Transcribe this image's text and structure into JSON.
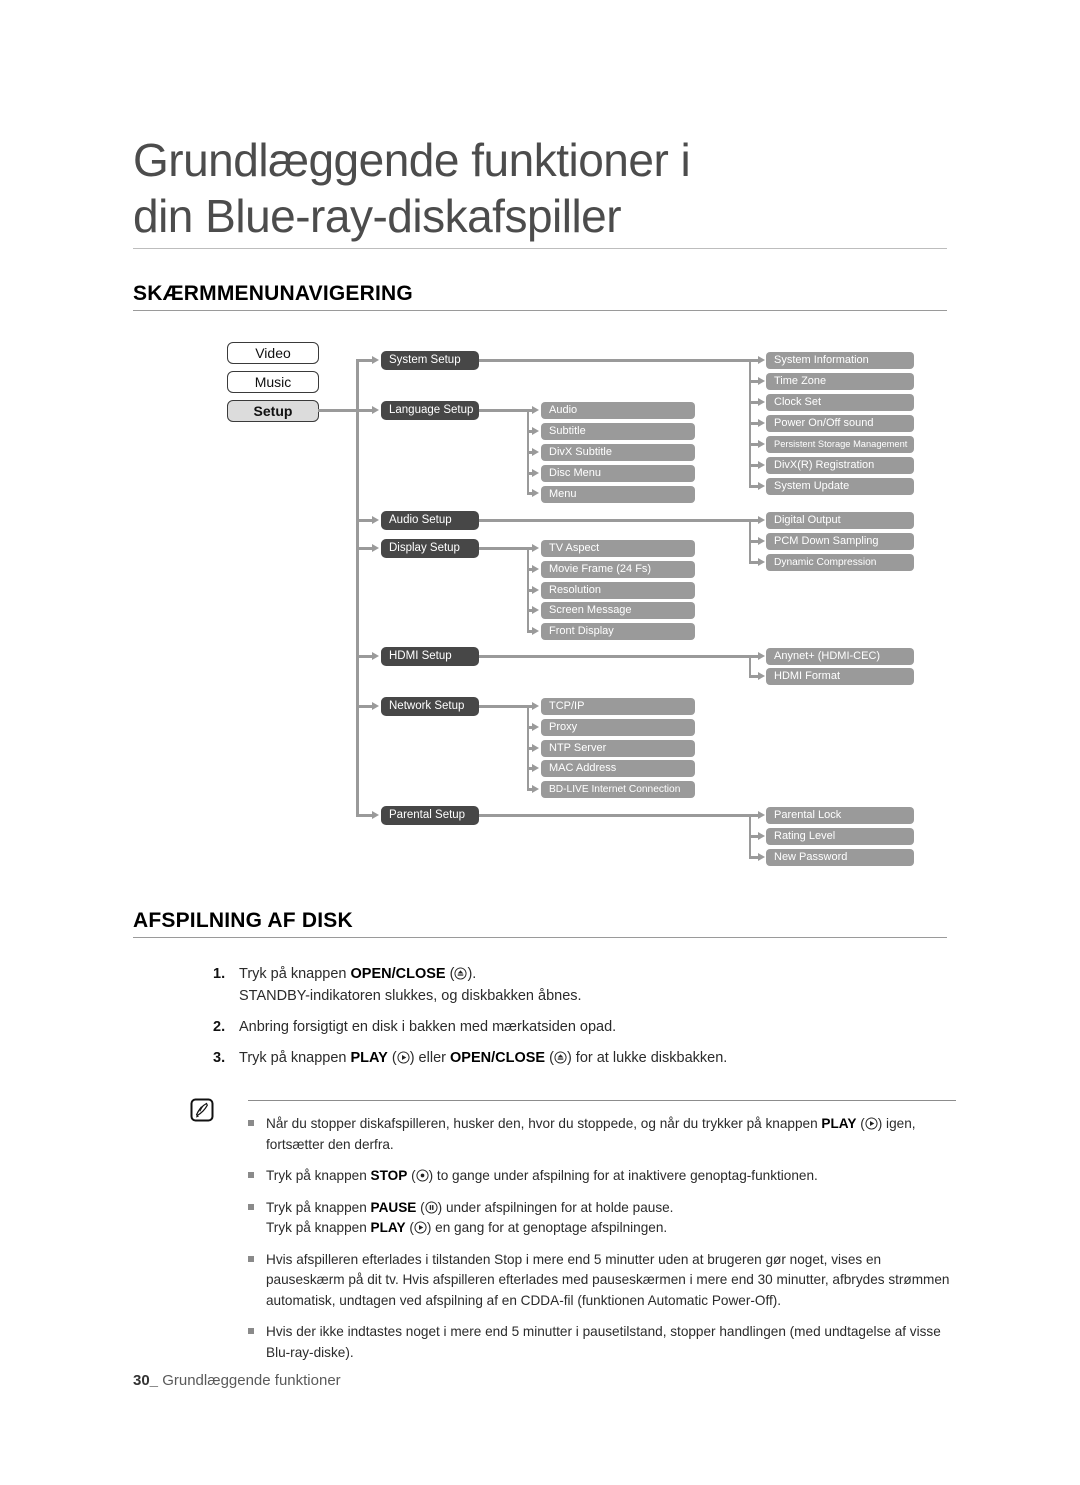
{
  "chapter": {
    "title_line1": "Grundlæggende funktioner i",
    "title_line2": "din Blue-ray-diskafspiller"
  },
  "sections": {
    "menu_nav": "SKÆRMMENUNAVIGERING",
    "disc_play": "AFSPILNING AF DISK"
  },
  "diagram": {
    "sources": [
      {
        "label": "Video",
        "selected": false
      },
      {
        "label": "Music",
        "selected": false
      },
      {
        "label": "Setup",
        "selected": true
      }
    ],
    "level1": [
      {
        "label": "System Setup"
      },
      {
        "label": "Language Setup"
      },
      {
        "label": "Audio Setup"
      },
      {
        "label": "Display Setup"
      },
      {
        "label": "HDMI Setup"
      },
      {
        "label": "Network Setup"
      },
      {
        "label": "Parental Setup"
      }
    ],
    "language_children": [
      "Audio",
      "Subtitle",
      "DivX Subtitle",
      "Disc Menu",
      "Menu"
    ],
    "display_children": [
      "TV Aspect",
      "Movie Frame (24 Fs)",
      "Resolution",
      "Screen Message",
      "Front Display"
    ],
    "network_children": [
      "TCP/IP",
      "Proxy",
      "NTP Server",
      "MAC Address",
      "BD-LIVE Internet Connection"
    ],
    "system_children": [
      "System Information",
      "Time Zone",
      "Clock Set",
      "Power On/Off sound",
      "Persistent Storage Management",
      "DivX(R) Registration",
      "System Update"
    ],
    "audio_children": [
      "Digital Output",
      "PCM Down Sampling",
      "Dynamic Compression"
    ],
    "hdmi_children": [
      "Anynet+ (HDMI-CEC)",
      "HDMI Format"
    ],
    "parental_children": [
      "Parental Lock",
      "Rating Level",
      "New Password"
    ],
    "colors": {
      "level1_box": "#474747",
      "level2_box": "#9a9a9a",
      "selected_source": "#dcdcdc",
      "connector": "#9a9a9a"
    }
  },
  "steps": [
    {
      "number": "1.",
      "line1_pre": "Tryk på knappen ",
      "line1_bold": "OPEN/CLOSE",
      "line1_icon": "eject-icon",
      "line1_post": ").",
      "line2": "STANDBY-indikatoren slukkes, og diskbakken åbnes."
    },
    {
      "number": "2.",
      "text": "Anbring forsigtigt en disk i bakken med mærkatsiden opad."
    },
    {
      "number": "3.",
      "pre": "Tryk på knappen ",
      "bold1": "PLAY",
      "icon1": "play-icon",
      "mid": ") eller ",
      "bold2": "OPEN/CLOSE",
      "icon2": "eject-icon",
      "post": ") for at lukke diskbakken."
    }
  ],
  "note": {
    "icon": "note-pen-icon",
    "items": [
      {
        "pre": "Når du stopper diskafspilleren, husker den, hvor du stoppede, og når du trykker på knappen ",
        "bold": "PLAY",
        "icon": "play-icon",
        "post": ") igen, fortsætter den derfra."
      },
      {
        "pre": "Tryk på knappen ",
        "bold": "STOP",
        "icon": "stop-icon",
        "post": ") to gange under afspilning for at inaktivere genoptag-funktionen."
      },
      {
        "pre": "Tryk på knappen ",
        "bold": "PAUSE",
        "icon": "pause-icon",
        "post": ") under afspilningen for at holde pause.",
        "pre2": "Tryk på knappen ",
        "bold2": "PLAY",
        "icon2": "play-icon",
        "post2": ") en gang for at genoptage afspilningen."
      },
      {
        "text": "Hvis afspilleren efterlades i tilstanden Stop i mere end 5 minutter uden at brugeren gør noget, vises en pauseskærm på dit tv. Hvis afspilleren efterlades med pauseskærmen i mere end 30 minutter, afbrydes strømmen automatisk, undtagen ved afspilning af en CDDA-fil (funktionen Automatic Power-Off)."
      },
      {
        "text": "Hvis der ikke indtastes noget i mere end 5 minutter i pausetilstand, stopper handlingen (med undtagelse af visse Blu-ray-diske)."
      }
    ]
  },
  "footer": {
    "page": "30_",
    "label": "Grundlæggende funktioner"
  }
}
